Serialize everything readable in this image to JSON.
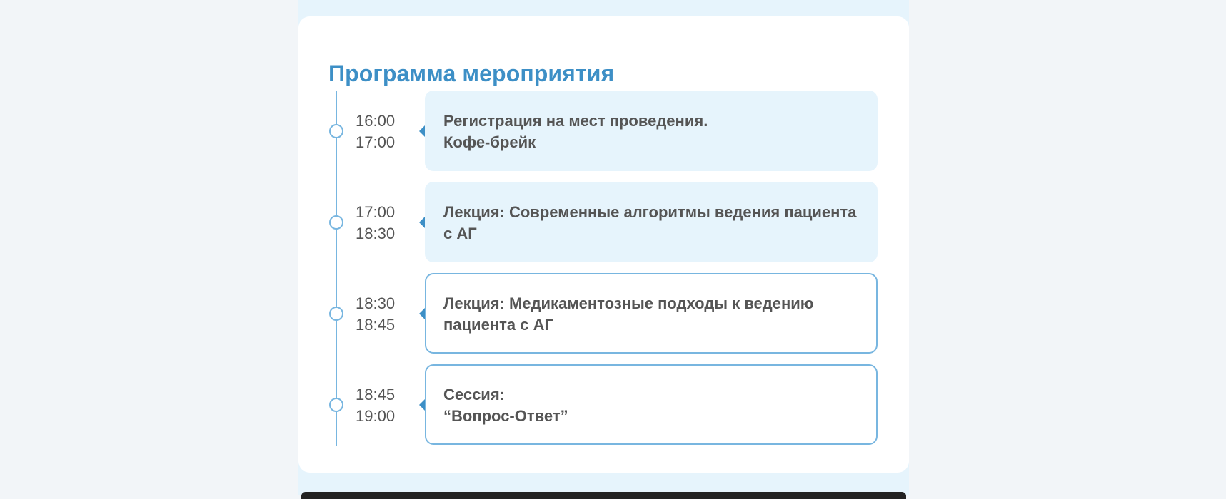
{
  "program": {
    "title": "Программа мероприятия",
    "items": [
      {
        "start": "16:00",
        "end": "17:00",
        "lines": [
          "Регистрация на мест проведения.",
          "Кофе-брейк"
        ],
        "style": "filled"
      },
      {
        "start": "17:00",
        "end": "18:30",
        "lines": [
          "Лекция: Современные алгоритмы ведения пациента",
          "с АГ"
        ],
        "style": "filled"
      },
      {
        "start": "18:30",
        "end": "18:45",
        "lines": [
          "Лекция: Медикаментозные подходы к ведению",
          "пациента с АГ"
        ],
        "style": "outline"
      },
      {
        "start": "18:45",
        "end": "19:00",
        "lines": [
          "Сессия:",
          "“Вопрос-Ответ”"
        ],
        "style": "outline"
      }
    ]
  },
  "colors": {
    "accent": "#3d8fc6",
    "timeline": "#78b6e0",
    "item_fill": "#e6f4fc",
    "text": "#555555",
    "page_bg": "#f2f5f8"
  },
  "icons": {
    "timeline_marker": "circle-marker-icon",
    "pointer": "left-pointer-icon"
  }
}
